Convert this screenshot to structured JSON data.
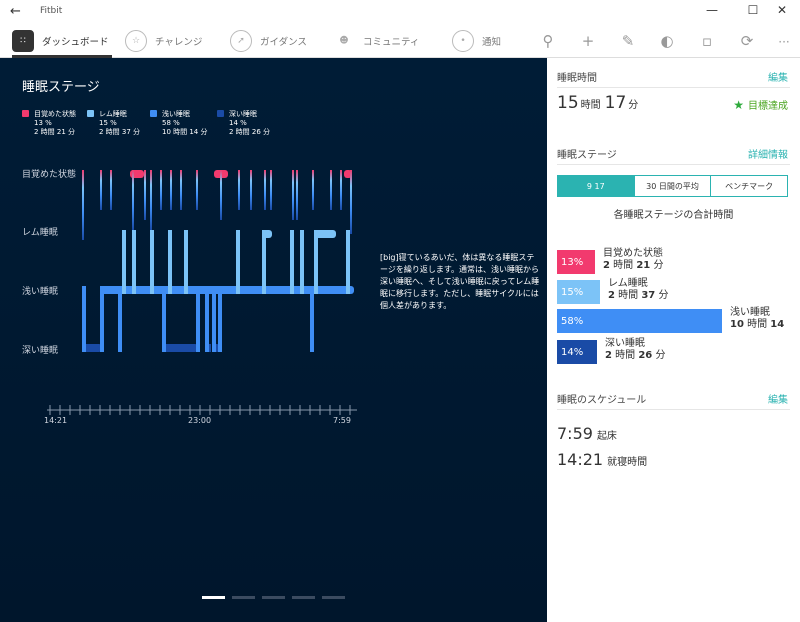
{
  "app": {
    "title": "Fitbit"
  },
  "nav": {
    "tabs": [
      {
        "label": "ダッシュボード"
      },
      {
        "label": "チャレンジ"
      },
      {
        "label": "ガイダンス"
      },
      {
        "label": "コミュニティ"
      },
      {
        "label": "通知"
      }
    ]
  },
  "toolbar": {
    "more": "···"
  },
  "left": {
    "title": "睡眠ステージ",
    "legend": [
      {
        "name": "目覚めた状態",
        "pct": "13 %",
        "dur": "2 時間 21 分",
        "color": "#f23a6e"
      },
      {
        "name": "レム睡眠",
        "pct": "15 %",
        "dur": "2 時間 37 分",
        "color": "#7cc3f7"
      },
      {
        "name": "浅い睡眠",
        "pct": "58 %",
        "dur": "10 時間 14 分",
        "color": "#3f8ef5"
      },
      {
        "name": "深い睡眠",
        "pct": "14 %",
        "dur": "2 時間 26 分",
        "color": "#1a4ba6"
      }
    ],
    "ylabels": [
      "目覚めた状態",
      "レム睡眠",
      "浅い睡眠",
      "深い睡眠"
    ],
    "xlabels": [
      "14:21",
      "23:00",
      "7:59"
    ],
    "description": "[big]寝ているあいだ、体は異なる睡眠ステージを繰り返します。通常は、浅い睡眠から深い睡眠へ、そして浅い睡眠に戻ってレム睡眠に移行します。ただし、睡眠サイクルには個人差があります。"
  },
  "right": {
    "sleep_time": {
      "title": "睡眠時間",
      "edit": "編集",
      "hours": "15",
      "hours_unit": "時間",
      "minutes": "17",
      "minutes_unit": "分",
      "goal": "目標達成"
    },
    "stages": {
      "title": "睡眠ステージ",
      "details": "詳細情報",
      "segments": [
        "9 17",
        "30 日間の平均",
        "ベンチマーク"
      ],
      "subtitle": "各睡眠ステージの合計時間",
      "bars": [
        {
          "pct": "13%",
          "name": "目覚めた状態",
          "h": "2",
          "hu": "時間",
          "m": "21",
          "mu": "分",
          "value": 0.13,
          "color": "#f23a6e"
        },
        {
          "pct": "15%",
          "name": "レム睡眠",
          "h": "2",
          "hu": "時間",
          "m": "37",
          "mu": "分",
          "value": 0.15,
          "color": "#7cc3f7"
        },
        {
          "pct": "58%",
          "name": "浅い睡眠",
          "h": "10",
          "hu": "時間",
          "m": "14",
          "mu": "",
          "value": 0.58,
          "color": "#3f8ef5"
        },
        {
          "pct": "14%",
          "name": "深い睡眠",
          "h": "2",
          "hu": "時間",
          "m": "26",
          "mu": "分",
          "value": 0.14,
          "color": "#1a4ba6"
        }
      ]
    },
    "schedule": {
      "title": "睡眠のスケジュール",
      "edit": "編集",
      "wake_time": "7:59",
      "wake_label": "起床",
      "bed_time": "14:21",
      "bed_label": "就寝時間"
    }
  }
}
